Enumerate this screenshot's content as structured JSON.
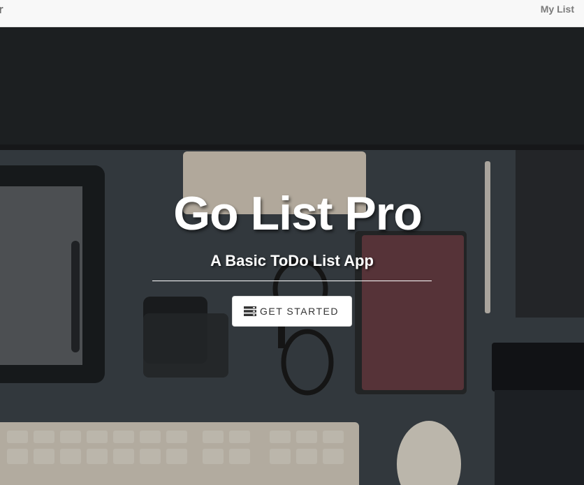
{
  "navbar": {
    "brand": "r",
    "links": [
      "My List"
    ]
  },
  "hero": {
    "title": "Go List Pro",
    "subtitle": "A Basic ToDo List App",
    "cta_label": "GET STARTED",
    "cta_icon": "server-icon"
  },
  "colors": {
    "navbar_bg": "#f8f8f8",
    "overlay": "#2a2f33",
    "button_bg": "#ffffff",
    "text_light": "#ffffff"
  }
}
